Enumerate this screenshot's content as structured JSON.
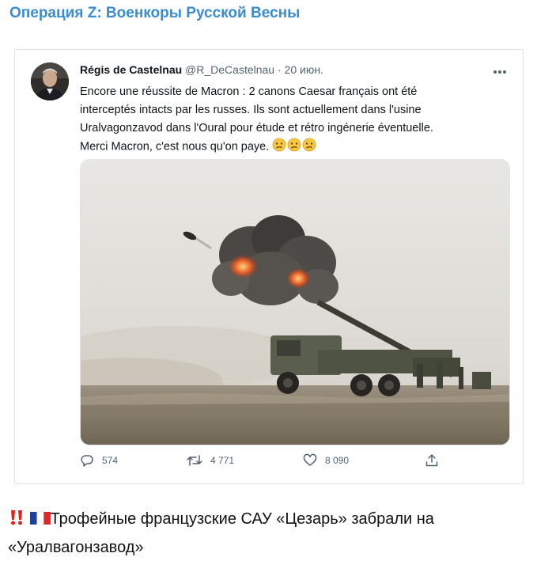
{
  "channel": {
    "title": "Операция Z: Военкоры Русской Весны"
  },
  "tweet": {
    "author_name": "Régis de Castelnau",
    "handle": "@R_DeCastelnau",
    "separator": "·",
    "date": "20 июн.",
    "text_lines": [
      "Encore une réussite de Macron : 2 canons Caesar français ont été",
      "interceptés intacts par les russes. Ils sont actuellement dans l'usine",
      "Uralvagonzavod dans l'Oural pour étude et rétro ingénerie éventuelle.",
      "Merci Macron, c'est nous qu'on paye."
    ],
    "emojis": [
      "confused-face",
      "confused-face",
      "confused-face"
    ],
    "metrics": {
      "replies": "574",
      "retweets": "4 771",
      "likes": "8 090"
    }
  },
  "caption": {
    "icons": [
      "double-exclamation-icon",
      "french-flag-icon"
    ],
    "text": "Трофейные французские САУ «Цезарь» забрали на «Уралвагонзавод»"
  }
}
